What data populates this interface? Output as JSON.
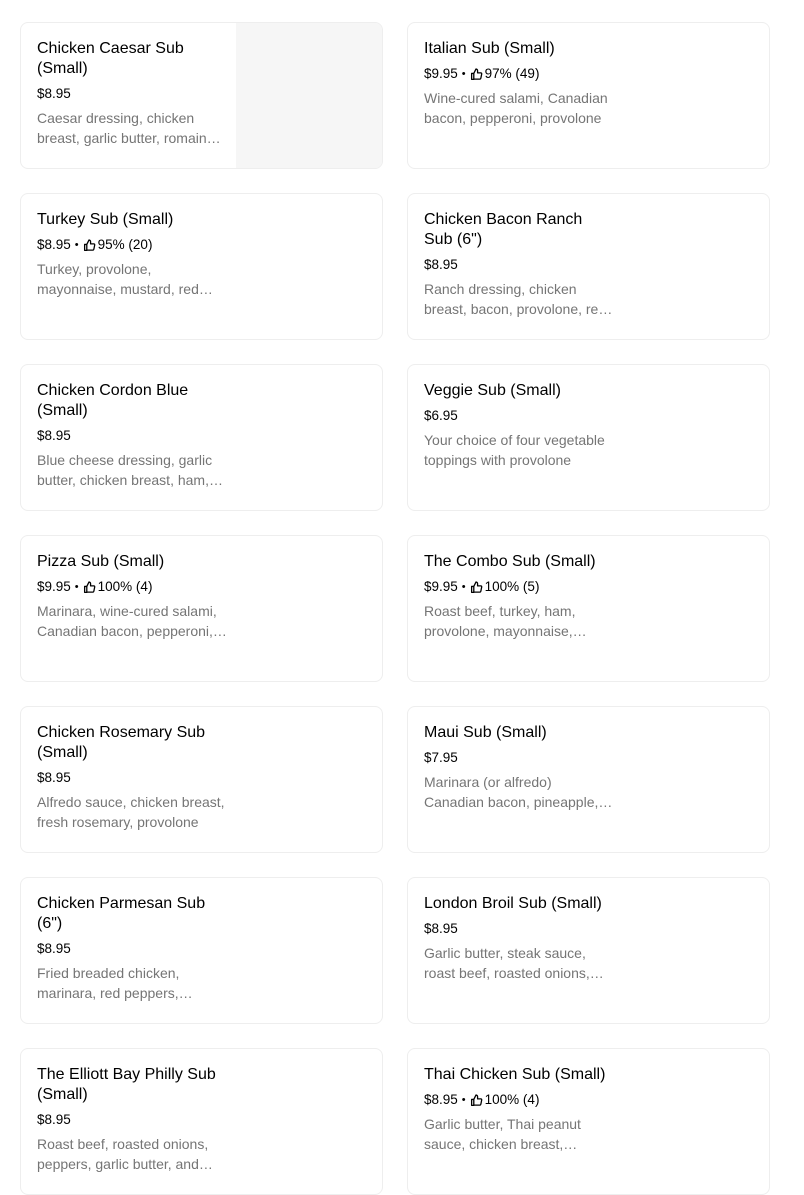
{
  "menu": {
    "items": [
      {
        "title": "Chicken Caesar Sub (Small)",
        "price": "$8.95",
        "rating": "",
        "description": "Caesar dressing, chicken breast, garlic butter, romaine lettuce, parmesan cheese",
        "has_image": true
      },
      {
        "title": "Italian Sub (Small)",
        "price": "$9.95",
        "rating": "97% (49)",
        "description": "Wine-cured salami, Canadian bacon, pepperoni, provolone",
        "has_image": false
      },
      {
        "title": "Turkey Sub (Small)",
        "price": "$8.95",
        "rating": "95% (20)",
        "description": "Turkey, provolone, mayonnaise, mustard, red onions, lettuce, tomatoes",
        "has_image": false
      },
      {
        "title": "Chicken Bacon Ranch Sub (6\")",
        "price": "$8.95",
        "rating": "",
        "description": "Ranch dressing, chicken breast, bacon, provolone, red onions",
        "has_image": false
      },
      {
        "title": "Chicken Cordon Blue (Small)",
        "price": "$8.95",
        "rating": "",
        "description": "Blue cheese dressing, garlic butter, chicken breast, ham, provolone",
        "has_image": false
      },
      {
        "title": "Veggie Sub (Small)",
        "price": "$6.95",
        "rating": "",
        "description": "Your choice of four vegetable toppings with provolone",
        "has_image": false
      },
      {
        "title": "Pizza Sub (Small)",
        "price": "$9.95",
        "rating": "100% (4)",
        "description": "Marinara, wine-cured salami, Canadian bacon, pepperoni, mozzarella",
        "has_image": false
      },
      {
        "title": "The Combo Sub (Small)",
        "price": "$9.95",
        "rating": "100% (5)",
        "description": "Roast beef, turkey, ham, provolone, mayonnaise, mustard",
        "has_image": false
      },
      {
        "title": "Chicken Rosemary Sub (Small)",
        "price": "$8.95",
        "rating": "",
        "description": "Alfredo sauce, chicken breast, fresh rosemary, provolone",
        "has_image": false
      },
      {
        "title": "Maui Sub (Small)",
        "price": "$7.95",
        "rating": "",
        "description": "Marinara (or alfredo) Canadian bacon, pineapple, mozzarella",
        "has_image": false
      },
      {
        "title": "Chicken Parmesan Sub (6\")",
        "price": "$8.95",
        "rating": "",
        "description": "Fried breaded chicken, marinara, red peppers, mozzarella",
        "has_image": false
      },
      {
        "title": "London Broil Sub (Small)",
        "price": "$8.95",
        "rating": "",
        "description": "Garlic butter, steak sauce, roast beef, roasted onions, provolone",
        "has_image": false
      },
      {
        "title": "The Elliott Bay Philly Sub (Small)",
        "price": "$8.95",
        "rating": "",
        "description": "Roast beef, roasted onions, peppers, garlic butter, and provolone",
        "has_image": false
      },
      {
        "title": "Thai Chicken Sub (Small)",
        "price": "$8.95",
        "rating": "100% (4)",
        "description": "Garlic butter, Thai peanut sauce, chicken breast, mozzarella",
        "has_image": false
      }
    ]
  },
  "separator": "•",
  "icons": {
    "rating": "thumbs-up-icon"
  },
  "colors": {
    "description_text": "#757575",
    "card_border": "#eeeeee",
    "image_placeholder": "#f6f6f6"
  }
}
